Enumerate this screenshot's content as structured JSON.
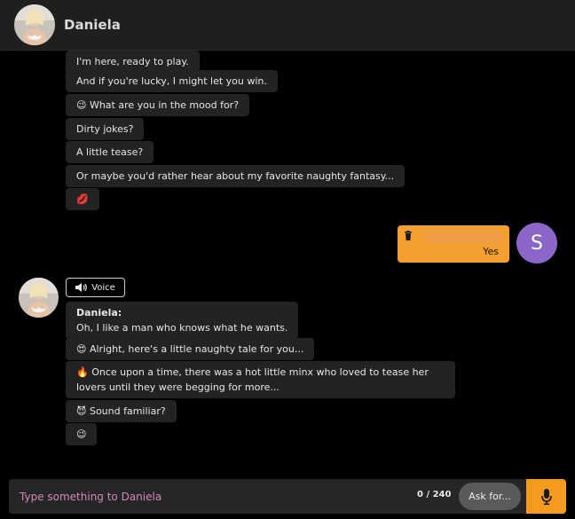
{
  "header": {
    "name": "Daniela"
  },
  "earlier_messages": [
    "I'm here, ready to play.",
    "And if you're lucky, I might let you win.",
    "😉 What are you in the mood for?",
    "Dirty jokes?",
    "A little tease?",
    "Or maybe you'd rather hear about my favorite naughty fantasy...",
    "💋"
  ],
  "user_message": {
    "text": "Yes",
    "avatar_letter": "S",
    "color": "#f4a02f"
  },
  "voice_button": {
    "label": "Voice"
  },
  "reply": {
    "sender": "Daniela:",
    "first_line": "Oh, I like a man who knows what he wants.",
    "messages": [
      "😍 Alright, here's a little naughty tale for you...",
      "🔥 Once upon a time, there was a hot little minx who loved to tease her lovers until they were begging for more...",
      "😈 Sound familiar?",
      "😉"
    ]
  },
  "composer": {
    "placeholder": "Type something to Daniela",
    "counter": "0 / 240",
    "ask_label": "Ask for...",
    "mic_color": "#f49a1f"
  },
  "icons": [
    "trash-icon",
    "speaker-icon",
    "microphone-icon"
  ]
}
